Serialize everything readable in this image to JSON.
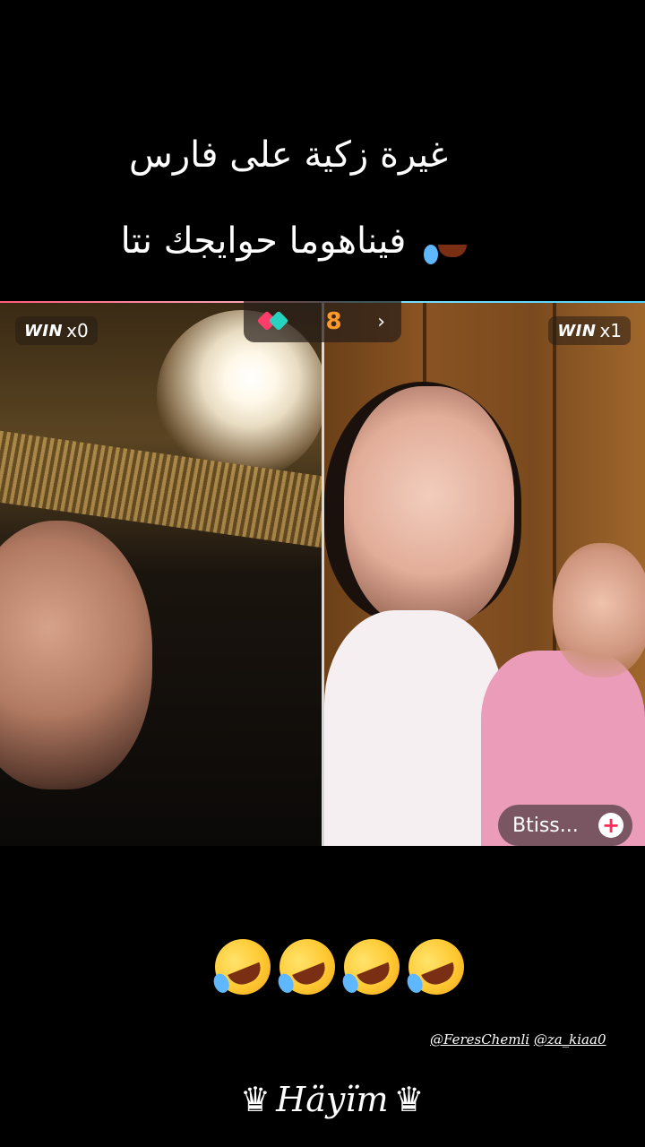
{
  "caption": {
    "line1": "غيرة زكية على فارس",
    "line2": "فيناهوما حوايجك نتا"
  },
  "live_battle": {
    "left": {
      "win_label": "WIN",
      "win_count": "x0"
    },
    "right": {
      "win_label": "WIN",
      "win_count": "x1"
    },
    "center_widget": {
      "count": "8",
      "chevron": "›",
      "icon": "gift-boxes-icon"
    },
    "follow": {
      "name": "Btiss...",
      "plus": "+"
    }
  },
  "emoji_row": {
    "icon": "rolling-on-floor-laughing-emoji",
    "count": 4
  },
  "credits": {
    "user1": "@FeresChemli",
    "user2": "@za_kiaa0"
  },
  "signature": {
    "text": "Häyïm",
    "crown": "♛"
  },
  "colors": {
    "accent_pink": "#fe2c55",
    "accent_teal": "#27d3c0",
    "count_orange": "#ff9a28"
  }
}
